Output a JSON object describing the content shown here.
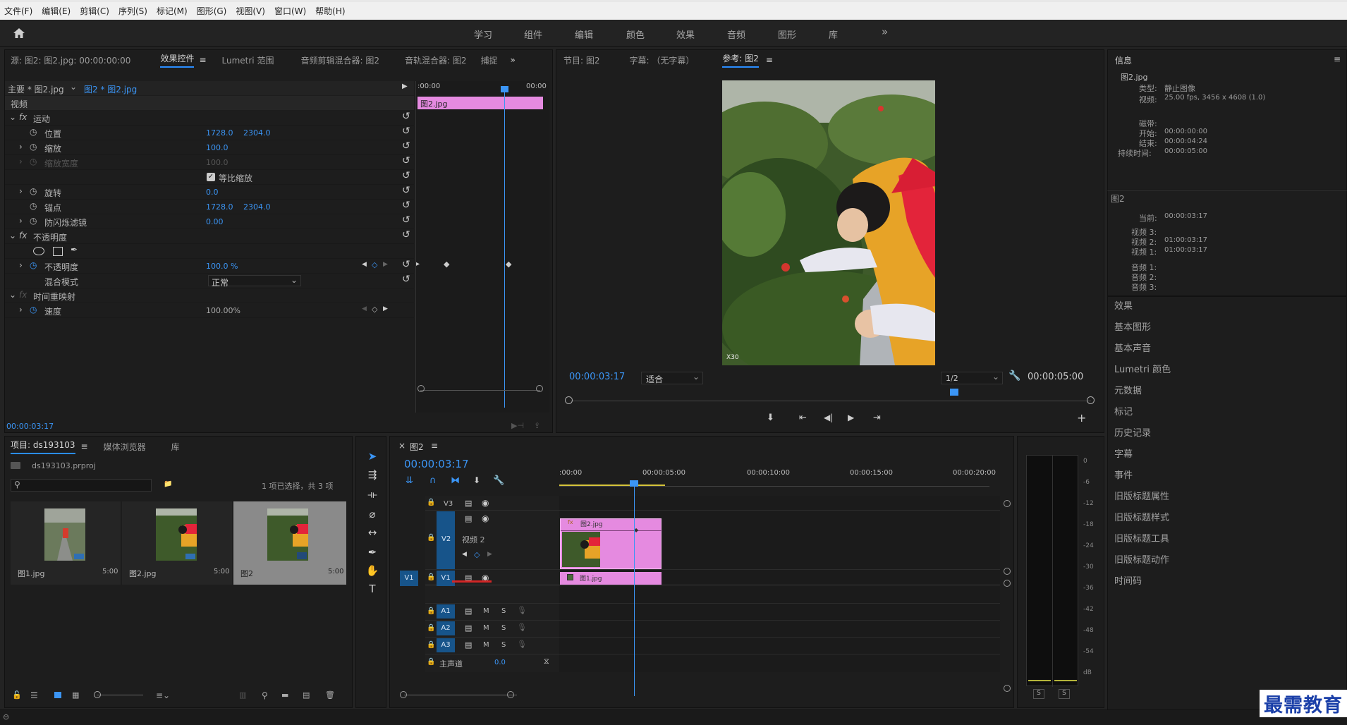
{
  "menu": [
    "文件(F)",
    "编辑(E)",
    "剪辑(C)",
    "序列(S)",
    "标记(M)",
    "图形(G)",
    "视图(V)",
    "窗口(W)",
    "帮助(H)"
  ],
  "workspace": {
    "tabs": [
      "学习",
      "组件",
      "编辑",
      "颜色",
      "效果",
      "音频",
      "图形",
      "库"
    ],
    "more": "»"
  },
  "source_panel": {
    "tabs": [
      "源: 图2: 图2.jpg: 00:00:00:00",
      "效果控件",
      "Lumetri 范围",
      "音频剪辑混合器: 图2",
      "音轨混合器: 图2",
      "捕捉"
    ],
    "master": "主要 * 图2.jpg",
    "clip": "图2 * 图2.jpg",
    "video_label": "视频",
    "tl_start": ":00:00",
    "tl_end": "00:00",
    "clip_bar": "图2.jpg",
    "timecode": "00:00:03:17"
  },
  "effects": {
    "motion": "运动",
    "position": "位置",
    "position_x": "1728.0",
    "position_y": "2304.0",
    "scale": "缩放",
    "scale_val": "100.0",
    "scale_width": "缩放宽度",
    "scale_width_val": "100.0",
    "uniform": "等比缩放",
    "rotation": "旋转",
    "rotation_val": "0.0",
    "anchor": "锚点",
    "anchor_x": "1728.0",
    "anchor_y": "2304.0",
    "flicker": "防闪烁滤镜",
    "flicker_val": "0.00",
    "opacity_group": "不透明度",
    "opacity": "不透明度",
    "opacity_val": "100.0 %",
    "blend": "混合模式",
    "blend_val": "正常",
    "remap": "时间重映射",
    "speed": "速度",
    "speed_val": "100.00%"
  },
  "program_panel": {
    "tabs": [
      "节目: 图2",
      "字幕: （无字幕）",
      "参考: 图2"
    ],
    "timecode": "00:00:03:17",
    "fit": "适合",
    "quality": "1/2",
    "duration": "00:00:05:00",
    "watermark": "X30"
  },
  "info": {
    "title": "信息",
    "clip_name": "图2.jpg",
    "type_label": "类型:",
    "type_val": "静止图像",
    "video_label": "视频:",
    "video_val": "25.00 fps, 3456 x 4608 (1.0)",
    "tape_label": "磁带:",
    "start_label": "开始:",
    "start_val": "00:00:00:00",
    "end_label": "结束:",
    "end_val": "00:00:04:24",
    "dur_label": "持续时间:",
    "dur_val": "00:00:05:00",
    "seq_name": "图2",
    "current_label": "当前:",
    "current_val": "00:00:03:17",
    "v3": "视频 3:",
    "v2": "视频 2:",
    "v2_val": "01:00:03:17",
    "v1": "视频 1:",
    "v1_val": "01:00:03:17",
    "a1": "音频 1:",
    "a2": "音频 2:",
    "a3": "音频 3:"
  },
  "side_items": [
    "效果",
    "基本图形",
    "基本声音",
    "Lumetri 颜色",
    "元数据",
    "标记",
    "历史记录",
    "字幕",
    "事件",
    "旧版标题属性",
    "旧版标题样式",
    "旧版标题工具",
    "旧版标题动作",
    "时间码"
  ],
  "project": {
    "tabs": [
      "项目: ds193103",
      "媒体浏览器",
      "库"
    ],
    "file": "ds193103.prproj",
    "selection": "1 项已选择，共 3 项",
    "items": [
      {
        "name": "图1.jpg",
        "dur": "5:00"
      },
      {
        "name": "图2.jpg",
        "dur": "5:00"
      },
      {
        "name": "图2",
        "dur": "5:00"
      }
    ]
  },
  "timeline": {
    "tab": "图2",
    "timecode": "00:00:03:17",
    "ruler": [
      ":00:00",
      "00:00:05:00",
      "00:00:10:00",
      "00:00:15:00",
      "00:00:20:00"
    ],
    "tracks": {
      "v3": "V3",
      "v2": "V2",
      "v1": "V1",
      "a1": "A1",
      "a2": "A2",
      "a3": "A3"
    },
    "v2_name": "视频 2",
    "master": "主声道",
    "master_val": "0.0",
    "clip_v2": "图2.jpg",
    "clip_v1": "图1.jpg",
    "m": "M",
    "s": "S"
  },
  "meter": {
    "labels": [
      "0",
      "-6",
      "-12",
      "-18",
      "-24",
      "-30",
      "-36",
      "-42",
      "-48",
      "-54",
      "dB"
    ],
    "s": "S"
  },
  "brand": "最需教育",
  "colors": {
    "accent": "#2a8dff",
    "clip": "#e58ae0",
    "track_blue": "#17548a"
  }
}
